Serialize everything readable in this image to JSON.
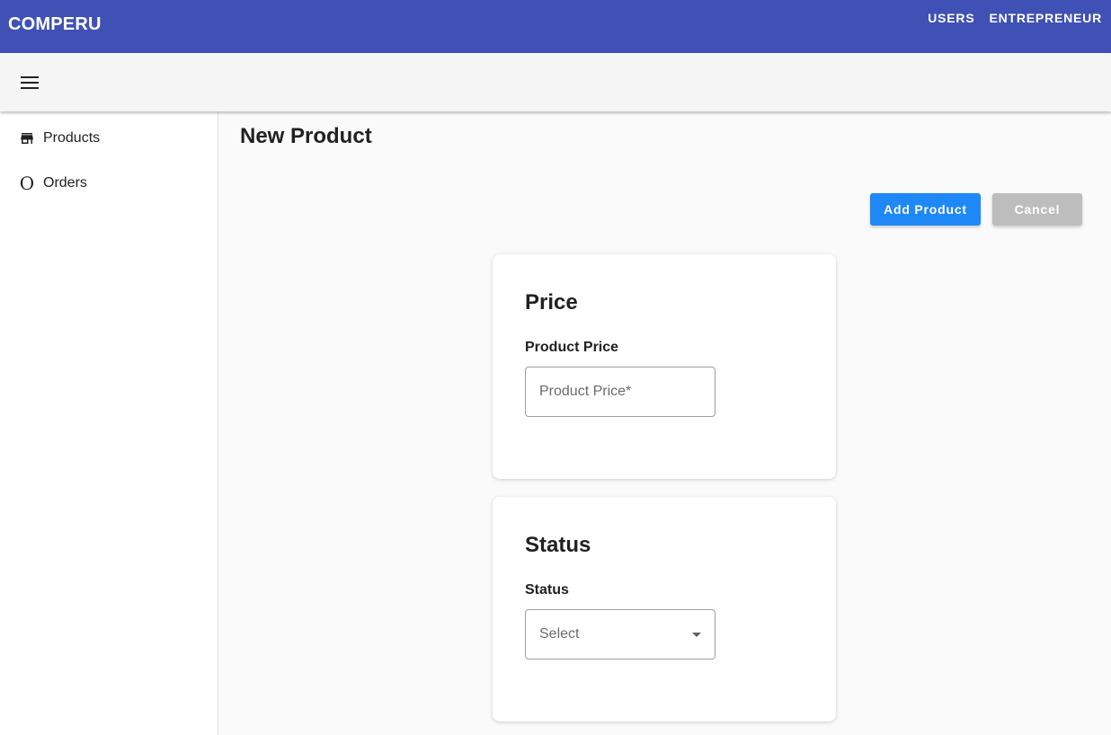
{
  "app": {
    "brand": "COMPERU",
    "nav": [
      "USERS",
      "ENTREPRENEUR"
    ]
  },
  "toolbar": {
    "menu_icon": "menu-icon"
  },
  "sidebar": {
    "items": [
      {
        "label": "Products",
        "icon": "store-icon"
      },
      {
        "label": "Orders",
        "icon": "orders-icon"
      }
    ]
  },
  "main": {
    "title": "New Product",
    "actions": {
      "add_label": "Add Product",
      "cancel_label": "Cancel",
      "add_color": "#1e88f7",
      "cancel_color": "#bdbdbd"
    },
    "price_card": {
      "title": "Price",
      "field_label": "Product Price",
      "placeholder": "Product Price*",
      "value": ""
    },
    "status_card": {
      "title": "Status",
      "field_label": "Status",
      "selected": "Select"
    }
  },
  "colors": {
    "primary": "#3f51b5",
    "accent": "#1e88f7"
  }
}
